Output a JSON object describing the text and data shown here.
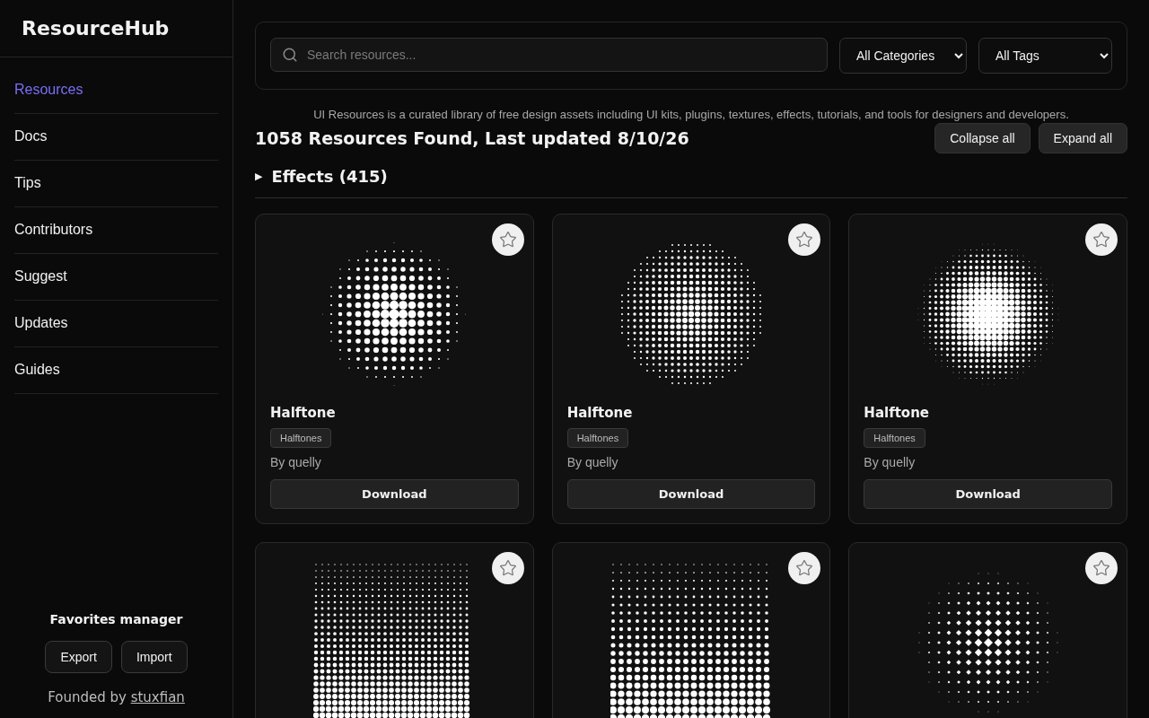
{
  "sidebar": {
    "logo": "ResourceHub",
    "items": [
      {
        "label": "Resources",
        "selected": true
      },
      {
        "label": "Docs",
        "selected": false
      },
      {
        "label": "Tips",
        "selected": false
      },
      {
        "label": "Contributors",
        "selected": false
      },
      {
        "label": "Suggest",
        "selected": false
      },
      {
        "label": "Updates",
        "selected": false
      },
      {
        "label": "Guides",
        "selected": false
      }
    ],
    "favorites": {
      "title": "Favorites manager",
      "buttons": [
        "Export",
        "Import"
      ]
    },
    "footer": {
      "text": "Founded by",
      "link": "stuxfian"
    }
  },
  "filters": {
    "search": {
      "placeholder": "Search resources..."
    },
    "category": "All Categories",
    "tags": "All Tags"
  },
  "description": "UI Resources is a curated library of free design assets including UI kits, plugins, textures, effects, tutorials, and tools for designers and developers.",
  "heading": "1058 Resources Found, Last updated 8/10/26",
  "actions": [
    "Collapse all",
    "Expand all"
  ],
  "group": {
    "title": "Effects (415)",
    "marker": "▶",
    "cards": [
      {
        "kind": "disc-coarse",
        "favorite": false,
        "title": "Halftone",
        "tag": "Halftones",
        "author": "By quelly",
        "button": "Download"
      },
      {
        "kind": "disc-fine",
        "favorite": false,
        "title": "Halftone",
        "tag": "Halftones",
        "author": "By quelly",
        "button": "Download"
      },
      {
        "kind": "disc-dense",
        "favorite": false,
        "title": "Halftone",
        "tag": "Halftones",
        "author": "By quelly",
        "button": "Download"
      },
      {
        "kind": "square-fine",
        "favorite": false
      },
      {
        "kind": "square-coarse",
        "favorite": false
      },
      {
        "kind": "diamond",
        "favorite": false
      }
    ]
  }
}
